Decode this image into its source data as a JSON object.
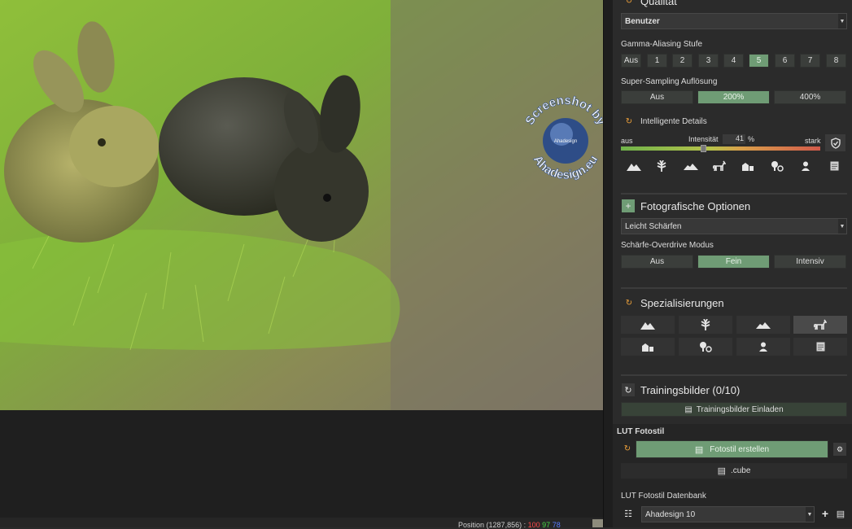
{
  "watermark": {
    "line1": "Screenshot by",
    "line2": "Ahadesign.eu",
    "globe_text": "Ahadesign"
  },
  "status": {
    "position_label": "Position",
    "position_value": "(1287,856) :",
    "r": "100",
    "g": "97",
    "b": "78"
  },
  "quality": {
    "title": "Qualität",
    "preset": "Benutzer",
    "gamma_label": "Gamma-Aliasing Stufe",
    "gamma_options": [
      "Aus",
      "1",
      "2",
      "3",
      "4",
      "5",
      "6",
      "7",
      "8"
    ],
    "gamma_selected": "5",
    "ss_label": "Super-Sampling Auflösung",
    "ss_options": [
      "Aus",
      "200%",
      "400%"
    ],
    "ss_selected": "200%"
  },
  "details": {
    "title": "Intelligente Details",
    "left": "aus",
    "mid": "Intensität",
    "value": "41",
    "unit": "%",
    "right": "stark",
    "level": 0.41,
    "icons": [
      "mountain-icon",
      "plant-icon",
      "hills-icon",
      "horse-icon",
      "buildings-icon",
      "objects-icon",
      "person-icon",
      "document-icon"
    ]
  },
  "photo_options": {
    "title": "Fotografische Optionen",
    "preset": "Leicht Schärfen",
    "overdrive_label": "Schärfe-Overdrive Modus",
    "overdrive_options": [
      "Aus",
      "Fein",
      "Intensiv"
    ],
    "overdrive_selected": "Fein"
  },
  "specializations": {
    "title": "Spezialisierungen",
    "icons": [
      "mountain-icon",
      "plant-icon",
      "hills-icon",
      "horse-icon",
      "buildings-icon",
      "objects-icon",
      "person-icon",
      "document-icon"
    ],
    "selected": "horse-icon"
  },
  "training": {
    "title": "Trainingsbilder (0/10)",
    "load_label": "Trainingsbilder Einladen"
  },
  "lut": {
    "title": "LUT Fotostil",
    "create_label": "Fotostil erstellen",
    "cube_label": ".cube",
    "db_label": "LUT Fotostil Datenbank",
    "db_value": "Ahadesign 10"
  },
  "colors": {
    "accent": "#6f9c75",
    "panel": "#2b2b2b",
    "orange": "#f0a23a"
  }
}
